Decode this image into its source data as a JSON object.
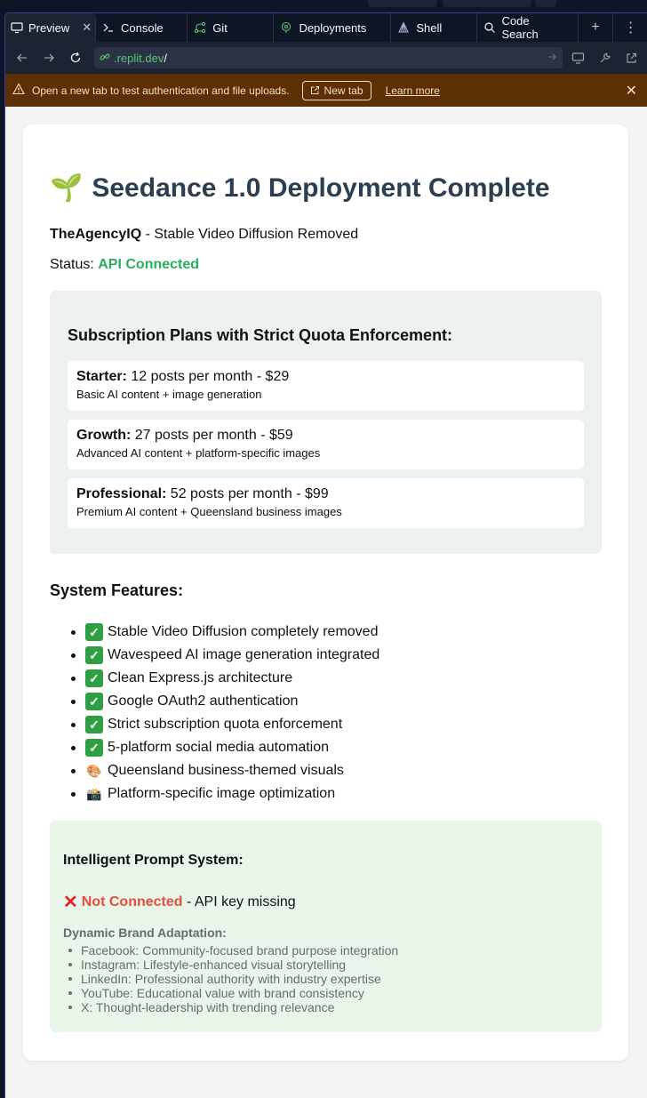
{
  "tabs": [
    {
      "label": "Preview",
      "icon": "monitor-icon"
    },
    {
      "label": "Console",
      "icon": "terminal-icon"
    },
    {
      "label": "Git",
      "icon": "git-icon"
    },
    {
      "label": "Deployments",
      "icon": "deployments-icon"
    },
    {
      "label": "Shell",
      "icon": "shell-icon"
    },
    {
      "label": "Code Search",
      "icon": "search-icon"
    }
  ],
  "address": {
    "host": ".replit.dev",
    "path": "/"
  },
  "banner": {
    "message": "Open a new tab to test authentication and file uploads.",
    "new_tab": "New tab",
    "learn_more": "Learn more"
  },
  "page": {
    "title_emoji": "🌱",
    "title": "Seedance 1.0 Deployment Complete",
    "brand": "TheAgencyIQ",
    "subtitle_rest": " - Stable Video Diffusion Removed",
    "status_label": "Status: ",
    "status_value": "API Connected",
    "plans_title": "Subscription Plans with Strict Quota Enforcement:",
    "plans": [
      {
        "name": "Starter:",
        "detail": " 12 posts per month - $29",
        "desc": "Basic AI content + image generation"
      },
      {
        "name": "Growth:",
        "detail": " 27 posts per month - $59",
        "desc": "Advanced AI content + platform-specific images"
      },
      {
        "name": "Professional:",
        "detail": " 52 posts per month - $99",
        "desc": "Premium AI content + Queensland business images"
      }
    ],
    "features_title": "System Features:",
    "features": [
      {
        "emoji": "✓",
        "text": "Stable Video Diffusion completely removed"
      },
      {
        "emoji": "✓",
        "text": "Wavespeed AI image generation integrated"
      },
      {
        "emoji": "✓",
        "text": "Clean Express.js architecture"
      },
      {
        "emoji": "✓",
        "text": "Google OAuth2 authentication"
      },
      {
        "emoji": "✓",
        "text": "Strict subscription quota enforcement"
      },
      {
        "emoji": "✓",
        "text": "5-platform social media automation"
      },
      {
        "emoji": "🎨",
        "text": "Queensland business-themed visuals"
      },
      {
        "emoji": "📸",
        "text": "Platform-specific image optimization"
      }
    ],
    "prompt_title": "Intelligent Prompt System:",
    "prompt_status": "Not Connected",
    "prompt_status_rest": " - API key missing",
    "dba_title": "Dynamic Brand Adaptation:",
    "dba_items": [
      "Facebook: Community-focused brand purpose integration",
      "Instagram: Lifestyle-enhanced visual storytelling",
      "LinkedIn: Professional authority with industry expertise",
      "YouTube: Educational value with brand consistency",
      "X: Thought-leadership with trending relevance"
    ]
  },
  "colors": {
    "ide_bg": "#0e1525",
    "banner_bg": "#5c2f04",
    "title": "#2c3e50",
    "status_ok": "#27ae60",
    "status_error": "#e74c3c",
    "plans_bg": "#ecf0f1",
    "prompt_bg": "#e8f5e9"
  }
}
